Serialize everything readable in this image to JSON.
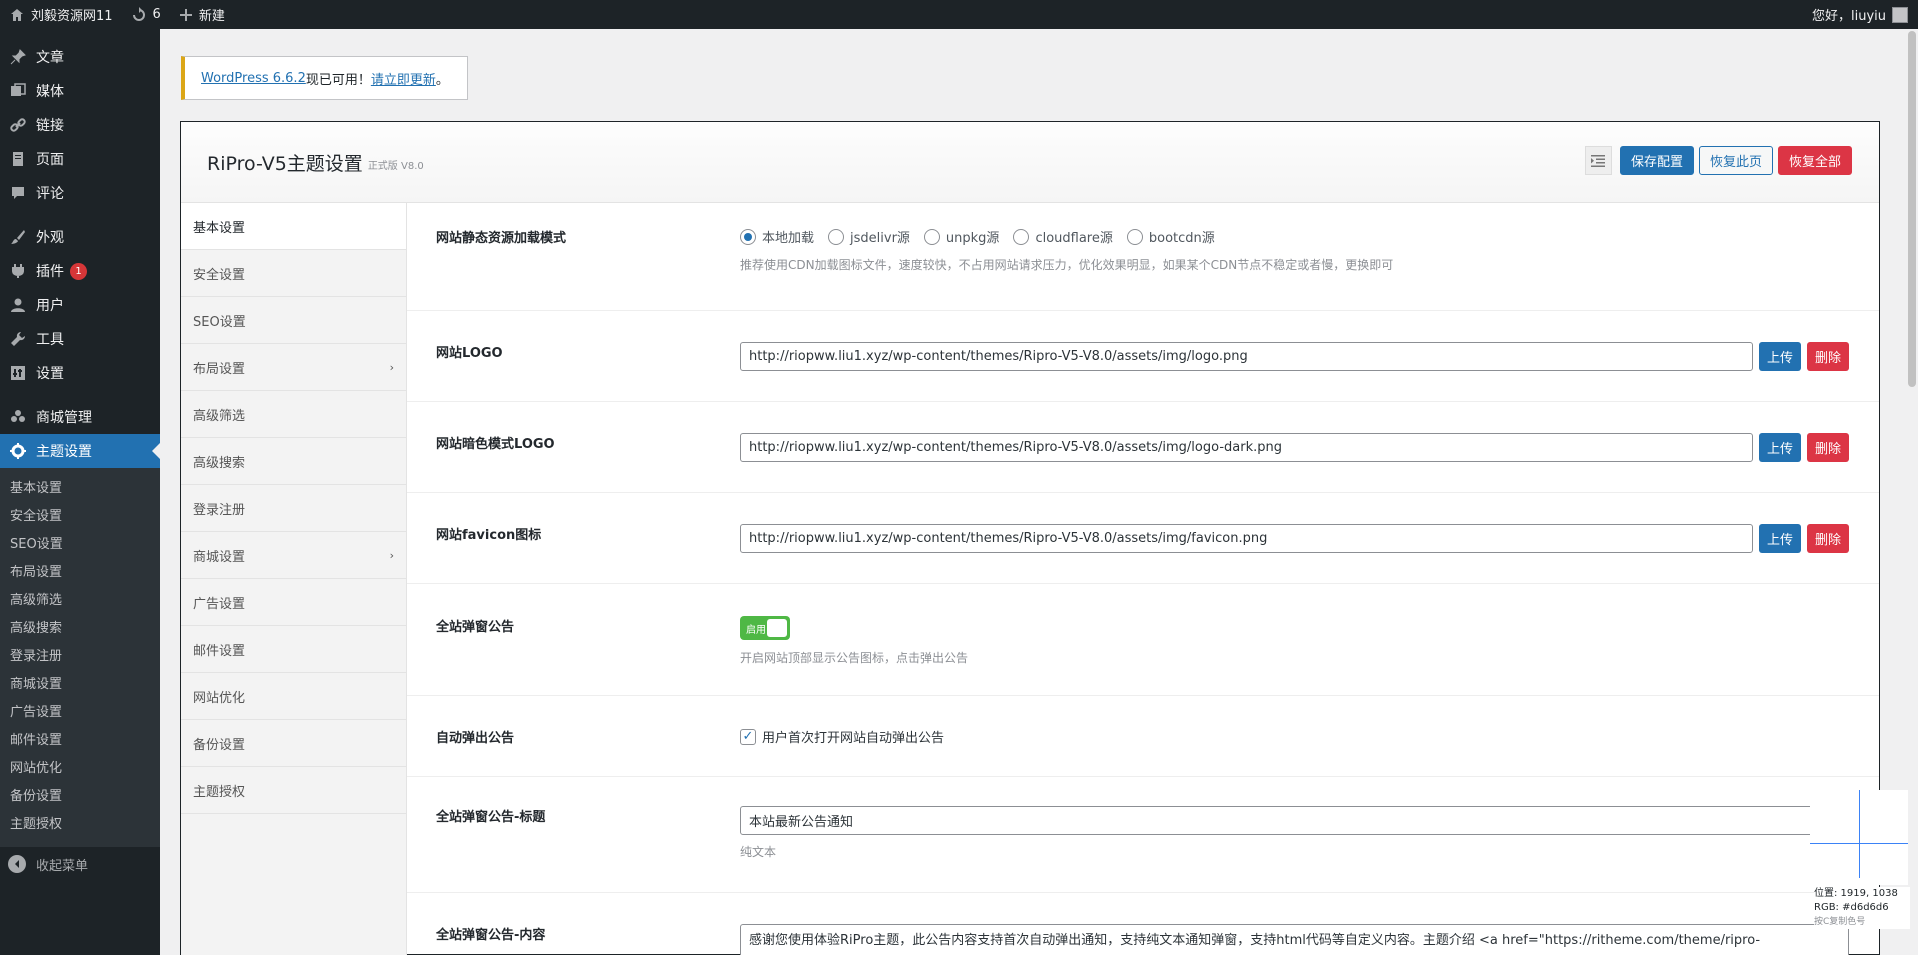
{
  "adminbar": {
    "site_name": "刘毅资源网11",
    "updates_count": "6",
    "new_label": "新建",
    "greeting": "您好，liuyiu"
  },
  "menu": {
    "items": [
      {
        "label": "文章",
        "icon": "pin-icon"
      },
      {
        "label": "媒体",
        "icon": "media-icon"
      },
      {
        "label": "链接",
        "icon": "link-icon"
      },
      {
        "label": "页面",
        "icon": "page-icon"
      },
      {
        "label": "评论",
        "icon": "comment-icon"
      },
      {
        "label": "外观",
        "icon": "brush-icon"
      },
      {
        "label": "插件",
        "icon": "plugin-icon",
        "badge": "1"
      },
      {
        "label": "用户",
        "icon": "user-icon"
      },
      {
        "label": "工具",
        "icon": "wrench-icon"
      },
      {
        "label": "设置",
        "icon": "settings-icon"
      },
      {
        "label": "商城管理",
        "icon": "group-icon"
      },
      {
        "label": "主题设置",
        "icon": "gear-icon"
      }
    ],
    "submenu": [
      "基本设置",
      "安全设置",
      "SEO设置",
      "布局设置",
      "高级筛选",
      "高级搜索",
      "登录注册",
      "商城设置",
      "广告设置",
      "邮件设置",
      "网站优化",
      "备份设置",
      "主题授权"
    ],
    "collapse_label": "收起菜单"
  },
  "notice": {
    "link1": "WordPress 6.6.2",
    "text": "现已可用！",
    "link2": "请立即更新",
    "end": "。"
  },
  "panel": {
    "title": "RiPro-V5主题设置",
    "version": "正式版 V8.0",
    "save_label": "保存配置",
    "restore_page_label": "恢复此页",
    "restore_all_label": "恢复全部"
  },
  "tabs": [
    {
      "label": "基本设置",
      "active": true
    },
    {
      "label": "安全设置"
    },
    {
      "label": "SEO设置"
    },
    {
      "label": "布局设置",
      "arrow": true
    },
    {
      "label": "高级筛选"
    },
    {
      "label": "高级搜索"
    },
    {
      "label": "登录注册"
    },
    {
      "label": "商城设置",
      "arrow": true
    },
    {
      "label": "广告设置"
    },
    {
      "label": "邮件设置"
    },
    {
      "label": "网站优化"
    },
    {
      "label": "备份设置"
    },
    {
      "label": "主题授权"
    }
  ],
  "fields": {
    "static": {
      "label": "网站静态资源加载模式",
      "options": [
        "本地加载",
        "jsdelivr源",
        "unpkg源",
        "cloudflare源",
        "bootcdn源"
      ],
      "selected": "本地加载",
      "desc": "推荐使用CDN加载图标文件，速度较快，不占用网站请求压力，优化效果明显，如果某个CDN节点不稳定或者慢，更换即可"
    },
    "logo": {
      "label": "网站LOGO",
      "value": "http://riopww.liu1.xyz/wp-content/themes/Ripro-V5-V8.0/assets/img/logo.png"
    },
    "logo_dark": {
      "label": "网站暗色模式LOGO",
      "value": "http://riopww.liu1.xyz/wp-content/themes/Ripro-V5-V8.0/assets/img/logo-dark.png"
    },
    "favicon": {
      "label": "网站favicon图标",
      "value": "http://riopww.liu1.xyz/wp-content/themes/Ripro-V5-V8.0/assets/img/favicon.png"
    },
    "upload_label": "上传",
    "delete_label": "删除",
    "popup": {
      "label": "全站弹窗公告",
      "toggle_label": "启用",
      "desc": "开启网站顶部显示公告图标，点击弹出公告"
    },
    "auto_popup": {
      "label": "自动弹出公告",
      "check_label": "用户首次打开网站自动弹出公告"
    },
    "popup_title": {
      "label": "全站弹窗公告-标题",
      "value": "本站最新公告通知",
      "desc": "纯文本"
    },
    "popup_content": {
      "label": "全站弹窗公告-内容",
      "value": "感谢您使用体验RiPro主题，此公告内容支持首次自动弹出通知，支持纯文本通知弹窗，支持html代码等自定义内容。主题介绍 <a href=\"https://ritheme.com/theme/ripro-"
    }
  },
  "picker": {
    "position": "位置: 1919, 1038",
    "rgb": "RGB: #d6d6d6",
    "hint": "按C复制色号"
  },
  "colors": {
    "accent": "#2271b1",
    "danger": "#dc3545",
    "toggle": "#4fb845",
    "adminbar": "#1d2327"
  }
}
